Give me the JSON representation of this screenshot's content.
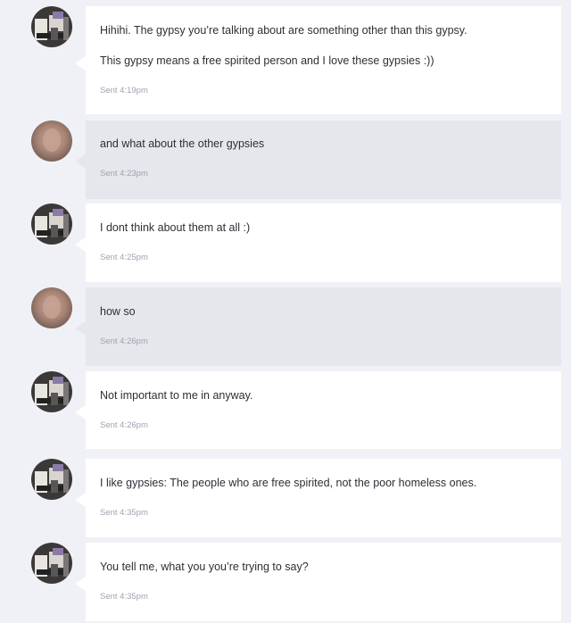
{
  "messages": [
    {
      "from": "me",
      "avatar_icon": "user-photo-icon",
      "lines": [
        "Hihihi. The gypsy you’re talking about are something other than this gypsy.",
        "This gypsy means a free spirited person and I love these gypsies :))"
      ],
      "sent": "Sent 4:19pm"
    },
    {
      "from": "them",
      "avatar_icon": "blurred-user-photo-icon",
      "lines": [
        "and what about the other gypsies"
      ],
      "sent": "Sent 4:23pm"
    },
    {
      "from": "me",
      "avatar_icon": "user-photo-icon",
      "lines": [
        "I dont think about them at all :)"
      ],
      "sent": "Sent 4:25pm"
    },
    {
      "from": "them",
      "avatar_icon": "blurred-user-photo-icon",
      "lines": [
        "how so"
      ],
      "sent": "Sent 4:26pm"
    },
    {
      "from": "me",
      "avatar_icon": "user-photo-icon",
      "lines": [
        "Not important to me in anyway."
      ],
      "sent": "Sent 4:26pm"
    },
    {
      "from": "me",
      "avatar_icon": "user-photo-icon",
      "lines": [
        "I like gypsies: The people who are free spirited, not the poor homeless ones."
      ],
      "sent": "Sent 4:35pm"
    },
    {
      "from": "me",
      "avatar_icon": "user-photo-icon",
      "lines": [
        "You tell me, what you you’re trying to say?"
      ],
      "sent": "Sent 4:35pm"
    }
  ],
  "colors": {
    "page_bg": "#f0f1f6",
    "my_bubble": "#ffffff",
    "their_bubble": "#e6e7ed",
    "text": "#2d2f36",
    "timestamp": "#9ea3b0"
  }
}
